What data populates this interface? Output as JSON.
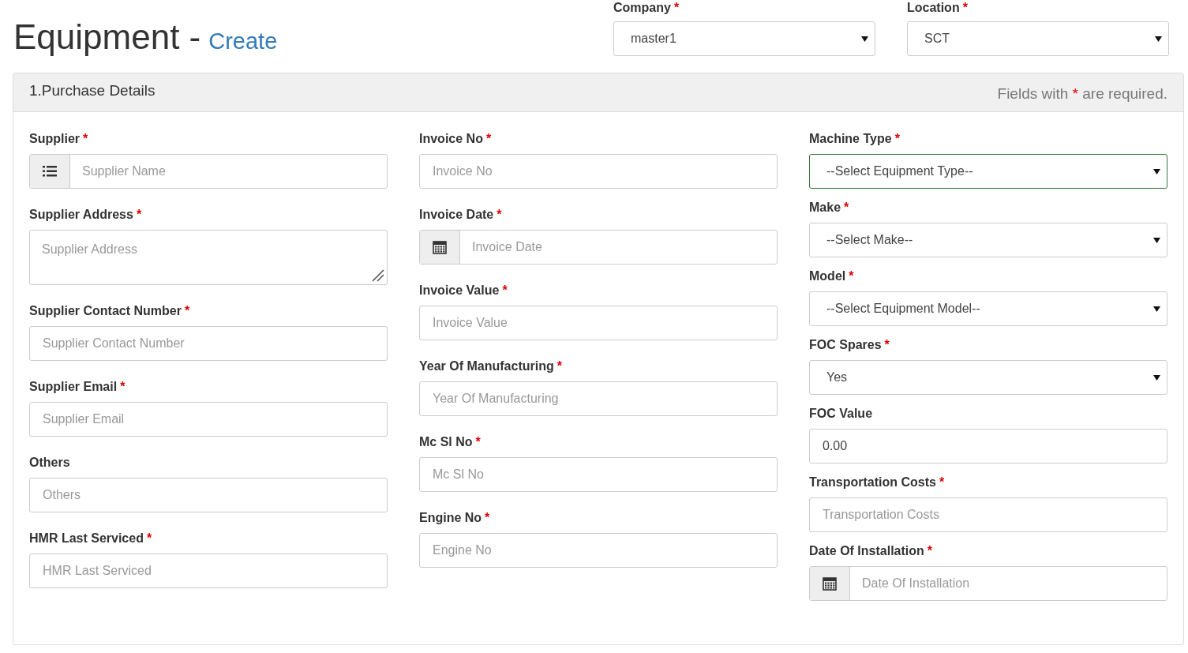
{
  "page_title": {
    "text": "Equipment -",
    "subtitle": "Create"
  },
  "header_selects": [
    {
      "label": "Company",
      "mark": "*",
      "value": "master1"
    },
    {
      "label": "Location",
      "mark": "*",
      "value": "SCT"
    }
  ],
  "panel": {
    "title": "1.Purchase Details",
    "note": {
      "before": "Fields with",
      "mark": "*",
      "after": "are required."
    },
    "columns": [
      [
        {
          "kind": "list-addon",
          "label": "Supplier",
          "mark": "*",
          "placeholder": "Supplier Name",
          "focused": false
        },
        {
          "kind": "textarea",
          "label": "Supplier Address",
          "mark": "*",
          "placeholder": "Supplier Address",
          "focused": false
        },
        {
          "kind": "input",
          "label": "Supplier Contact Number",
          "mark": "*",
          "placeholder": "Supplier Contact Number",
          "focused": false
        },
        {
          "kind": "input",
          "label": "Supplier Email",
          "mark": "*",
          "placeholder": "Supplier Email",
          "focused": false
        },
        {
          "kind": "input",
          "label": "Others",
          "placeholder": "Others",
          "focused": false
        },
        {
          "kind": "input",
          "label": "HMR Last Serviced",
          "mark": "*",
          "placeholder": "HMR Last Serviced",
          "focused": false
        }
      ],
      [
        {
          "kind": "input",
          "label": "Invoice No",
          "mark": "*",
          "placeholder": "Invoice No",
          "focused": false
        },
        {
          "kind": "calendar-addon",
          "label": "Invoice Date",
          "mark": "*",
          "placeholder": "Invoice Date",
          "focused": false
        },
        {
          "kind": "input",
          "label": "Invoice Value",
          "mark": "*",
          "placeholder": "Invoice Value",
          "focused": false
        },
        {
          "kind": "input",
          "label": "Year Of Manufacturing",
          "mark": "*",
          "placeholder": "Year Of Manufacturing",
          "focused": false
        },
        {
          "kind": "input",
          "label": "Mc Sl No",
          "mark": "*",
          "placeholder": "Mc Sl No",
          "focused": false
        },
        {
          "kind": "input",
          "label": "Engine No",
          "mark": "*",
          "placeholder": "Engine No",
          "focused": false
        }
      ],
      [
        {
          "kind": "select",
          "label": "Machine Type",
          "mark": "*",
          "value": "--Select Equipment Type--",
          "focused": true
        },
        {
          "kind": "select",
          "label": "Make",
          "mark": "*",
          "value": "--Select Make--",
          "focused": false
        },
        {
          "kind": "select",
          "label": "Model",
          "mark": "*",
          "value": "--Select Equipment Model--",
          "focused": false
        },
        {
          "kind": "select",
          "label": "FOC Spares",
          "mark": "*",
          "value": "Yes",
          "focused": false
        },
        {
          "kind": "input",
          "label": "FOC Value",
          "value": "0.00",
          "focused": false
        },
        {
          "kind": "input",
          "label": "Transportation Costs",
          "mark": "*",
          "placeholder": "Transportation Costs",
          "focused": false
        },
        {
          "kind": "calendar-addon",
          "label": "Date Of Installation",
          "mark": "*",
          "placeholder": "Date Of Installation",
          "focused": false
        }
      ]
    ]
  }
}
